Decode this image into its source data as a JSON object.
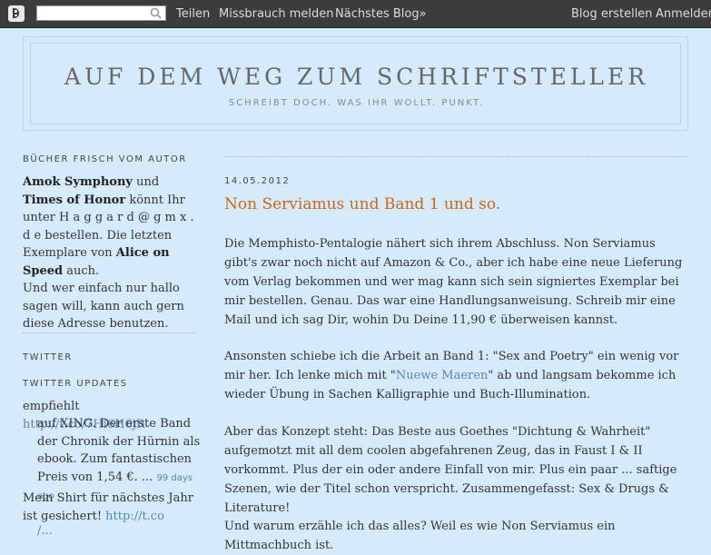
{
  "navbar": {
    "logo": "blogger-logo",
    "search_placeholder": "",
    "share": "Teilen",
    "report": "Missbrauch melden",
    "next_blog": "Nächstes Blog»",
    "create_blog": "Blog erstellen",
    "sign_in": "Anmelden"
  },
  "header": {
    "title": "AUF DEM WEG ZUM SCHRIFTSTELLER",
    "description": "SCHREIBT DOCH. WAS IHR WOLLT. PUNKT."
  },
  "sidebar": {
    "books_heading": "BÜCHER FRISCH VOM AUTOR",
    "books_text": {
      "b1": "Amok Symphony",
      "t1": " und ",
      "b2": "Times of Honor",
      "t2": " könnt Ihr unter H a g g a r d @ g m x . d e bestellen. Die letzten Exemplare von ",
      "b3": "Alice on Speed",
      "t3": " auch.",
      "t4": "Und wer einfach nur hallo sagen will, kann auch gern diese Adresse benutzen."
    },
    "twitter_heading": "TWITTER",
    "updates_heading": "TWITTER UPDATES",
    "tweets": [
      {
        "prefix": "empfiehlt ",
        "link": "http://t.co/7Hl6H6jR",
        "text": "auf XING. Der erste Band der Chronik der Hürnin als ebook. Zum fantastischen Preis von 1,54 €. ... ",
        "ago": "99 days ago"
      },
      {
        "prefix": "Mein Shirt für nächstes Jahr ist gesichert! ",
        "link": "http://t.co",
        "tail": "/..."
      }
    ]
  },
  "post": {
    "date": "14.05.2012",
    "title": "Non Serviamus und Band 1 und so.",
    "p1": "Die Memphisto-Pentalogie nähert sich ihrem Abschluss. Non Serviamus gibt's zwar noch nicht auf Amazon & Co., aber ich habe eine neue Lieferung vom Verlag bekommen und wer mag kann sich sein signiertes Exemplar bei mir bestellen. Genau. Das war eine Handlungsanweisung. Schreib mir eine Mail und ich sag Dir, wohin Du Deine 11,90 € überweisen kannst.",
    "p2_a": "Ansonsten schiebe ich die Arbeit an Band 1: \"Sex and Poetry\" ein wenig vor mir her. Ich lenke mich mit \"",
    "p2_link": "Nuewe Maeren",
    "p2_b": "\" ab und langsam bekomme ich wieder Übung in Sachen Kalligraphie und Buch-Illumination.",
    "p3": "Aber das Konzept steht: Das Beste aus Goethes \"Dichtung & Wahrheit\" aufgemotzt mit all dem coolen abgefahrenen Zeug, das in Faust I & II vorkommt. Plus der ein oder andere Einfall von mir. Plus ein paar ... saftige Szenen, wie der Titel schon verspricht. Zusammengefasst: Sex & Drugs & Literature!",
    "p4": "Und warum erzähle ich das alles? Weil es wie Non Serviamus ein Mittmachbuch ist."
  }
}
